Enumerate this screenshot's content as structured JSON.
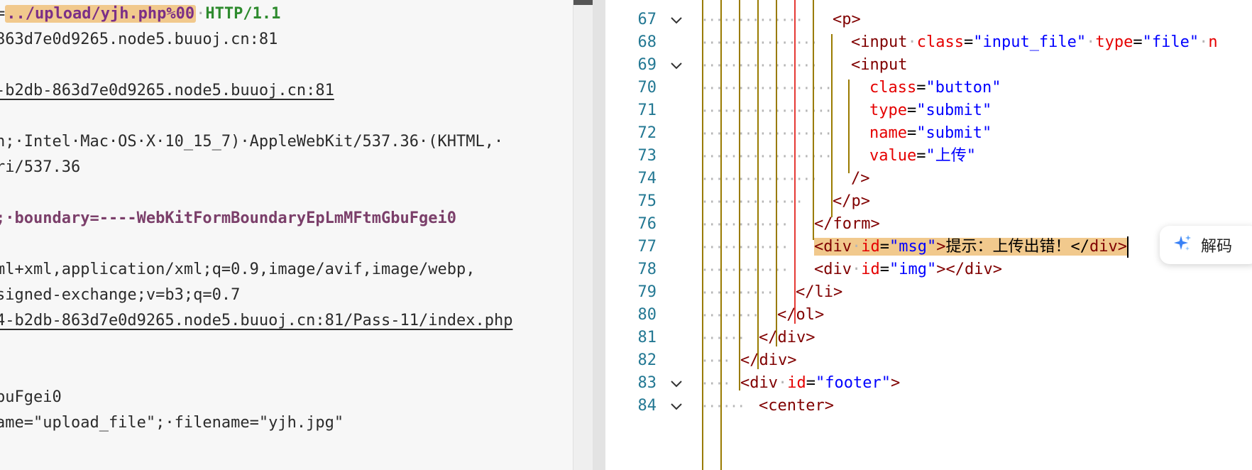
{
  "left_editor": {
    "lines": [
      {
        "segments": [
          {
            "text": "=",
            "cls": ""
          },
          {
            "text": "../upload/yjh.php%00",
            "cls": "hl path"
          },
          {
            "text": "·",
            "cls": "dotc"
          },
          {
            "text": "HTTP/1.1",
            "cls": "http"
          }
        ]
      },
      {
        "segments": [
          {
            "text": "863d7e0d9265.node5.buuoj.cn:81",
            "cls": ""
          }
        ]
      },
      {
        "segments": []
      },
      {
        "segments": [
          {
            "text": "-b2db-863d7e0d9265.node5.buuoj.cn:81",
            "cls": "ul"
          }
        ]
      },
      {
        "segments": []
      },
      {
        "segments": [
          {
            "text": "h;·Intel·Mac·OS·X·10_15_7)·AppleWebKit/537.36·(KHTML,·",
            "cls": ""
          }
        ]
      },
      {
        "segments": [
          {
            "text": "ri/537.36",
            "cls": ""
          }
        ]
      },
      {
        "segments": []
      },
      {
        "segments": [
          {
            "text": ";·boundary=----WebKitFormBoundaryEpLmMFtmGbuFgei0",
            "cls": "hdr-purple"
          }
        ]
      },
      {
        "segments": []
      },
      {
        "segments": [
          {
            "text": "ml+xml,application/xml;q=0.9,image/avif,image/webp,",
            "cls": ""
          }
        ]
      },
      {
        "segments": [
          {
            "text": "signed-exchange;v=b3;q=0.7",
            "cls": ""
          }
        ]
      },
      {
        "segments": [
          {
            "text": "4-b2db-863d7e0d9265.node5.buuoj.cn:81/Pass-11/index.php",
            "cls": "ul"
          }
        ]
      },
      {
        "segments": []
      },
      {
        "segments": []
      },
      {
        "segments": [
          {
            "text": "buFgei0",
            "cls": ""
          }
        ]
      },
      {
        "segments": [
          {
            "text": "ame=\"upload_file\";·filename=\"yjh.jpg\"",
            "cls": ""
          }
        ]
      }
    ]
  },
  "right_editor": {
    "lines": [
      {
        "num": "67",
        "fold": true,
        "indent": 7,
        "tokens": [
          [
            "tag",
            "<p>"
          ]
        ]
      },
      {
        "num": "68",
        "fold": false,
        "indent": 8,
        "tokens": [
          [
            "tag",
            "<input"
          ],
          [
            "dot",
            "·"
          ],
          [
            "attr",
            "class"
          ],
          [
            "txt",
            "="
          ],
          [
            "val",
            "\"input_file\""
          ],
          [
            "dot",
            "·"
          ],
          [
            "attr",
            "type"
          ],
          [
            "txt",
            "="
          ],
          [
            "val",
            "\"file\""
          ],
          [
            "dot",
            "·"
          ],
          [
            "attr",
            "n"
          ]
        ]
      },
      {
        "num": "69",
        "fold": true,
        "indent": 8,
        "tokens": [
          [
            "tag",
            "<input"
          ]
        ]
      },
      {
        "num": "70",
        "fold": false,
        "indent": 9,
        "tokens": [
          [
            "attr",
            "class"
          ],
          [
            "txt",
            "="
          ],
          [
            "val",
            "\"button\""
          ]
        ]
      },
      {
        "num": "71",
        "fold": false,
        "indent": 9,
        "tokens": [
          [
            "attr",
            "type"
          ],
          [
            "txt",
            "="
          ],
          [
            "val",
            "\"submit\""
          ]
        ]
      },
      {
        "num": "72",
        "fold": false,
        "indent": 9,
        "tokens": [
          [
            "attr",
            "name"
          ],
          [
            "txt",
            "="
          ],
          [
            "val",
            "\"submit\""
          ]
        ]
      },
      {
        "num": "73",
        "fold": false,
        "indent": 9,
        "tokens": [
          [
            "attr",
            "value"
          ],
          [
            "txt",
            "="
          ],
          [
            "val",
            "\"上传\""
          ]
        ]
      },
      {
        "num": "74",
        "fold": false,
        "indent": 8,
        "tokens": [
          [
            "tag",
            "/>"
          ]
        ]
      },
      {
        "num": "75",
        "fold": false,
        "indent": 7,
        "tokens": [
          [
            "tag",
            "</p>"
          ]
        ]
      },
      {
        "num": "76",
        "fold": false,
        "indent": 6,
        "tokens": [
          [
            "tag",
            "</form>"
          ]
        ]
      },
      {
        "num": "77",
        "fold": false,
        "indent": 6,
        "highlight": true,
        "tokens": [
          [
            "tag",
            "<div"
          ],
          [
            "dot",
            "·"
          ],
          [
            "attr",
            "id"
          ],
          [
            "txt",
            "="
          ],
          [
            "val",
            "\"msg\""
          ],
          [
            "tag",
            ">"
          ],
          [
            "txt",
            "提示：上传出错！</"
          ],
          [
            "tag",
            "div>"
          ]
        ]
      },
      {
        "num": "78",
        "fold": false,
        "indent": 6,
        "tokens": [
          [
            "tag",
            "<div"
          ],
          [
            "dot",
            "·"
          ],
          [
            "attr",
            "id"
          ],
          [
            "txt",
            "="
          ],
          [
            "val",
            "\"img\""
          ],
          [
            "tag",
            "></div>"
          ]
        ]
      },
      {
        "num": "79",
        "fold": false,
        "indent": 5,
        "tokens": [
          [
            "tag",
            "</li>"
          ]
        ]
      },
      {
        "num": "80",
        "fold": false,
        "indent": 4,
        "tokens": [
          [
            "tag",
            "</ol>"
          ]
        ]
      },
      {
        "num": "81",
        "fold": false,
        "indent": 3,
        "tokens": [
          [
            "tag",
            "</div>"
          ]
        ]
      },
      {
        "num": "82",
        "fold": false,
        "indent": 2,
        "tokens": [
          [
            "tag",
            "</div>"
          ]
        ]
      },
      {
        "num": "83",
        "fold": true,
        "indent": 2,
        "tokens": [
          [
            "tag",
            "<div"
          ],
          [
            "dot",
            "·"
          ],
          [
            "attr",
            "id"
          ],
          [
            "txt",
            "="
          ],
          [
            "val",
            "\"footer\""
          ],
          [
            "tag",
            ">"
          ]
        ]
      },
      {
        "num": "84",
        "fold": true,
        "indent": 3,
        "tokens": [
          [
            "tag",
            "<center>"
          ]
        ]
      }
    ]
  },
  "decode_button": {
    "label": "解码",
    "icon": "sparkle-icon",
    "icon_color": "#3b82f6"
  },
  "colors": {
    "highlight": "#f1c98d",
    "line_number": "#237893",
    "tag": "#800000",
    "attr": "#e50000",
    "value": "#0000ff"
  }
}
